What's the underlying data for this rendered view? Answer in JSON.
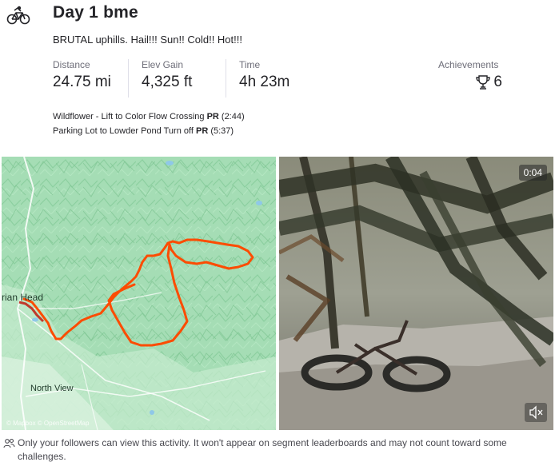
{
  "activity": {
    "title": "Day 1 bme",
    "description": "BRUTAL uphills. Hail!!! Sun!! Cold!! Hot!!!",
    "sport_icon": "mountain-bike-icon"
  },
  "stats": {
    "distance": {
      "label": "Distance",
      "value": "24.75 mi"
    },
    "elev_gain": {
      "label": "Elev Gain",
      "value": "4,325 ft"
    },
    "time": {
      "label": "Time",
      "value": "4h 23m"
    }
  },
  "achievements": {
    "label": "Achievements",
    "count": "6",
    "icon": "trophy-icon"
  },
  "segments": [
    {
      "name": "Wildflower - Lift to Color Flow Crossing",
      "badge": "PR",
      "time": "(2:44)"
    },
    {
      "name": "Parking Lot to Lowder Pond Turn off",
      "badge": "PR",
      "time": "(5:37)"
    }
  ],
  "map": {
    "labels": {
      "town_upper": "rian Head",
      "town_lower": "North View"
    },
    "attribution": "© Mapbox © OpenStreetMap",
    "route_color": "#fc4c02"
  },
  "video": {
    "duration": "0:04",
    "mute_icon": "mute-icon"
  },
  "privacy": {
    "text": "Only your followers can view this activity. It won't appear on segment leaderboards and may not count toward some challenges.",
    "icon": "followers-icon"
  }
}
